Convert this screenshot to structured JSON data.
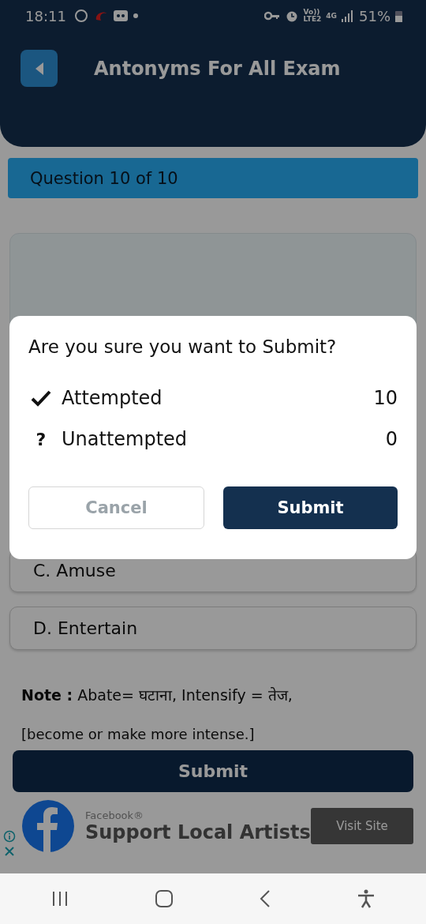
{
  "status_bar": {
    "time": "18:11",
    "network": [
      "Vo))",
      "LTE2",
      "4G"
    ],
    "battery": "51%"
  },
  "header": {
    "title": "Antonyms For All Exam"
  },
  "question_label": "Question 10 of 10",
  "options": [
    {
      "text": "C. Amuse"
    },
    {
      "text": "D. Entertain"
    }
  ],
  "note": {
    "line": "**Note :** Abate= घटाना, Intensify = तेज,",
    "detail": "[become or make more intense.]"
  },
  "submit_button": "Submit",
  "ad": {
    "advertiser": "Facebook®",
    "headline": "Support Local Artists",
    "button": "Visit Site"
  },
  "dialog": {
    "title": "Are you sure you want to Submit?",
    "rows": [
      {
        "kind": "check",
        "label": "Attempted",
        "count": "10"
      },
      {
        "kind": "mark",
        "mark": "?",
        "label": "Unattempted",
        "count": "0"
      }
    ],
    "cancel": {
      "label": "Cancel",
      "disabled": true
    },
    "submit": "Submit"
  }
}
